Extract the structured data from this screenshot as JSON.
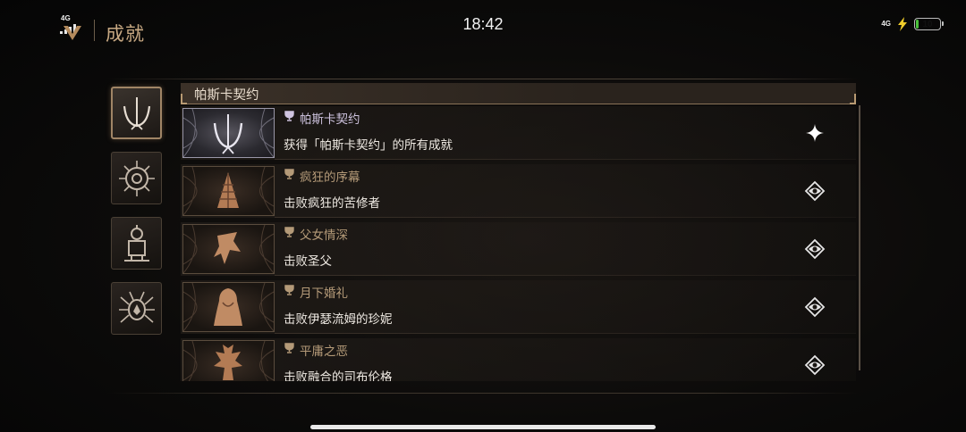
{
  "status_bar": {
    "time": "18:42",
    "left_network": "4G",
    "right_network": "4G",
    "battery_level": "10",
    "battery_color": "#4ac13a"
  },
  "header": {
    "title": "成就",
    "icon": "game-logo-icon"
  },
  "sidebar": {
    "tabs": [
      {
        "icon": "pascal-pact-emblem-icon",
        "active": true
      },
      {
        "icon": "compass-sigil-icon",
        "active": false
      },
      {
        "icon": "tower-sigil-icon",
        "active": false
      },
      {
        "icon": "spider-sigil-icon",
        "active": false
      }
    ]
  },
  "section": {
    "title": "帕斯卡契约"
  },
  "achievements": [
    {
      "title": "帕斯卡契约",
      "description": "获得「帕斯卡契约」的所有成就",
      "completed": true,
      "status_icon": "sparkle-star-icon",
      "trophy_icon": "trophy-icon"
    },
    {
      "title": "疯狂的序幕",
      "description": "击败疯狂的苦修者",
      "completed": false,
      "status_icon": "locked-eye-emblem-icon",
      "trophy_icon": "trophy-icon"
    },
    {
      "title": "父女情深",
      "description": "击败圣父",
      "completed": false,
      "status_icon": "locked-eye-emblem-icon",
      "trophy_icon": "trophy-icon"
    },
    {
      "title": "月下婚礼",
      "description": "击败伊瑟流姆的珍妮",
      "completed": false,
      "status_icon": "locked-eye-emblem-icon",
      "trophy_icon": "trophy-icon"
    },
    {
      "title": "平庸之恶",
      "description": "击败融合的司布伦格",
      "completed": false,
      "status_icon": "locked-eye-emblem-icon",
      "trophy_icon": "trophy-icon"
    }
  ],
  "colors": {
    "accent_gold": "#b49a78",
    "completed_lilac": "#cfc4e0",
    "background": "#0c0b0a"
  }
}
